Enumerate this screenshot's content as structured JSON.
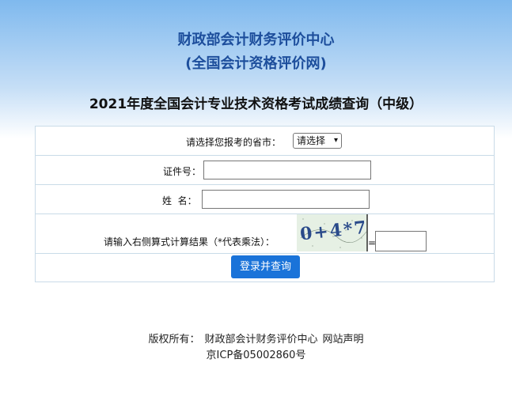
{
  "header": {
    "org_name": "财政部会计财务评价中心",
    "org_sub": "(全国会计资格评价网)",
    "page_title": "2021年度全国会计专业技术资格考试成绩查询（中级）"
  },
  "form": {
    "province_label": "请选择您报考的省市：",
    "province_selected": "请选择",
    "id_label": "证件号：",
    "id_value": "",
    "name_label": "姓  名：",
    "name_value": "",
    "captcha_label": "请输入右侧算式计算结果（*代表乘法）：",
    "captcha_text": "0+4*7",
    "equals": "=",
    "captcha_answer": "",
    "submit_label": "登录并查询"
  },
  "footer": {
    "copyright_label": "版权所有：",
    "copyright_org": "财政部会计财务评价中心",
    "statement_link": "网站声明",
    "icp": "京ICP备05002860号"
  }
}
